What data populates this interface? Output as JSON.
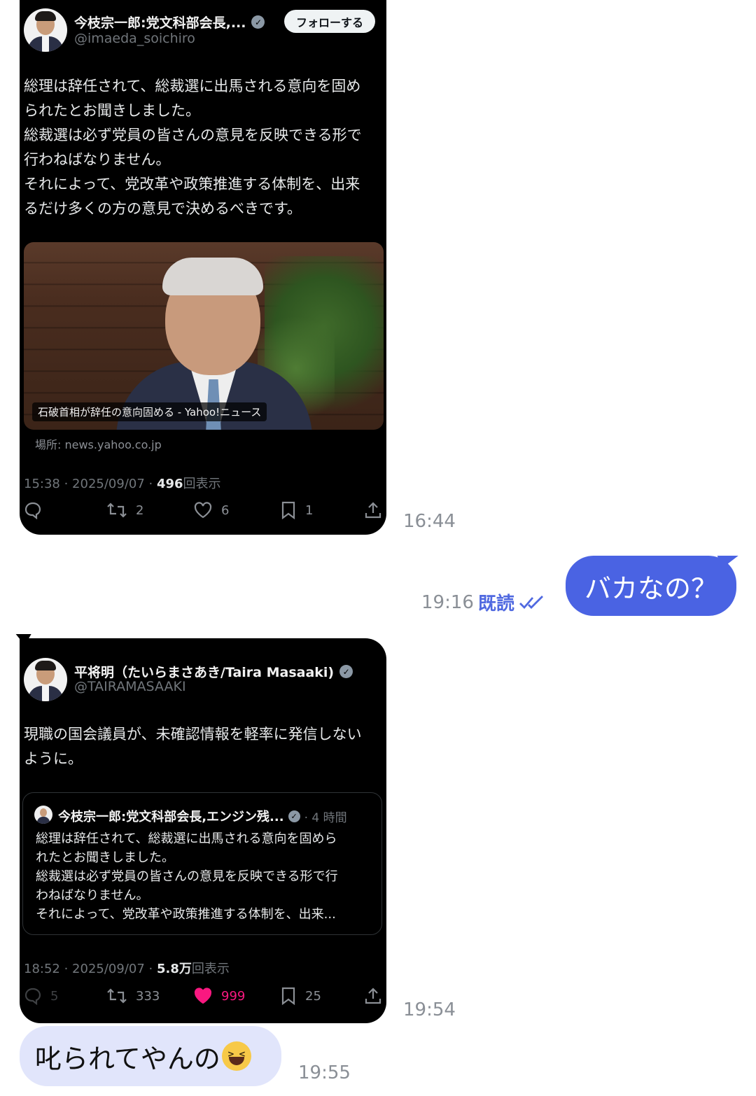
{
  "post1": {
    "author_name": "今枝宗一郎:党文科部会長,...",
    "handle": "@imaeda_soichiro",
    "follow_label": "フォローする",
    "text": "総理は辞任されて、総裁選に出馬される意向を固め\nられたとお聞きしました。\n総裁選は必ず党員の皆さんの意見を反映できる形で\n行わねばなりません。\nそれによって、党改革や政策推進する体制を、出来\nるだけ多くの方の意見で決めるべきです。",
    "news_caption": "石破首相が辞任の意向固める - Yahoo!ニュース",
    "news_source": "場所: news.yahoo.co.jp",
    "time_date": "15:38 · 2025/09/07 · ",
    "views": "496",
    "views_suffix": "回表示",
    "reposts": "2",
    "likes": "6",
    "bookmarks": "1"
  },
  "msg1_time": "16:44",
  "msg2": {
    "text": "バカなの？",
    "time": "19:16",
    "read_label": "既読"
  },
  "post2": {
    "author_name": "平将明（たいらまさあき/Taira Masaaki)",
    "handle": "@TAIRAMASAAKI",
    "text": "現職の国会議員が、未確認情報を軽率に発信しない\nように。",
    "quote": {
      "author_name": "今枝宗一郎:党文科部会長,エンジン残...",
      "time": "· 4 時間",
      "text": "総理は辞任されて、総裁選に出馬される意向を固めら\nれたとお聞きしました。\n総裁選は必ず党員の皆さんの意見を反映できる形で行\nわねばなりません。\nそれによって、党改革や政策推進する体制を、出来..."
    },
    "time_date": "18:52 · 2025/09/07 · ",
    "views": "5.8万",
    "views_suffix": "回表示",
    "replies": "5",
    "reposts": "333",
    "likes": "999",
    "bookmarks": "25"
  },
  "msg3_time": "19:54",
  "msg4": {
    "text": "叱られてやんの",
    "emoji": "laughing-face",
    "time": "19:55"
  },
  "colors": {
    "sent_bubble": "#4a63e3",
    "received_bubble": "#e1e5fb",
    "read_label": "#5069e0",
    "like_active": "#f91880"
  }
}
